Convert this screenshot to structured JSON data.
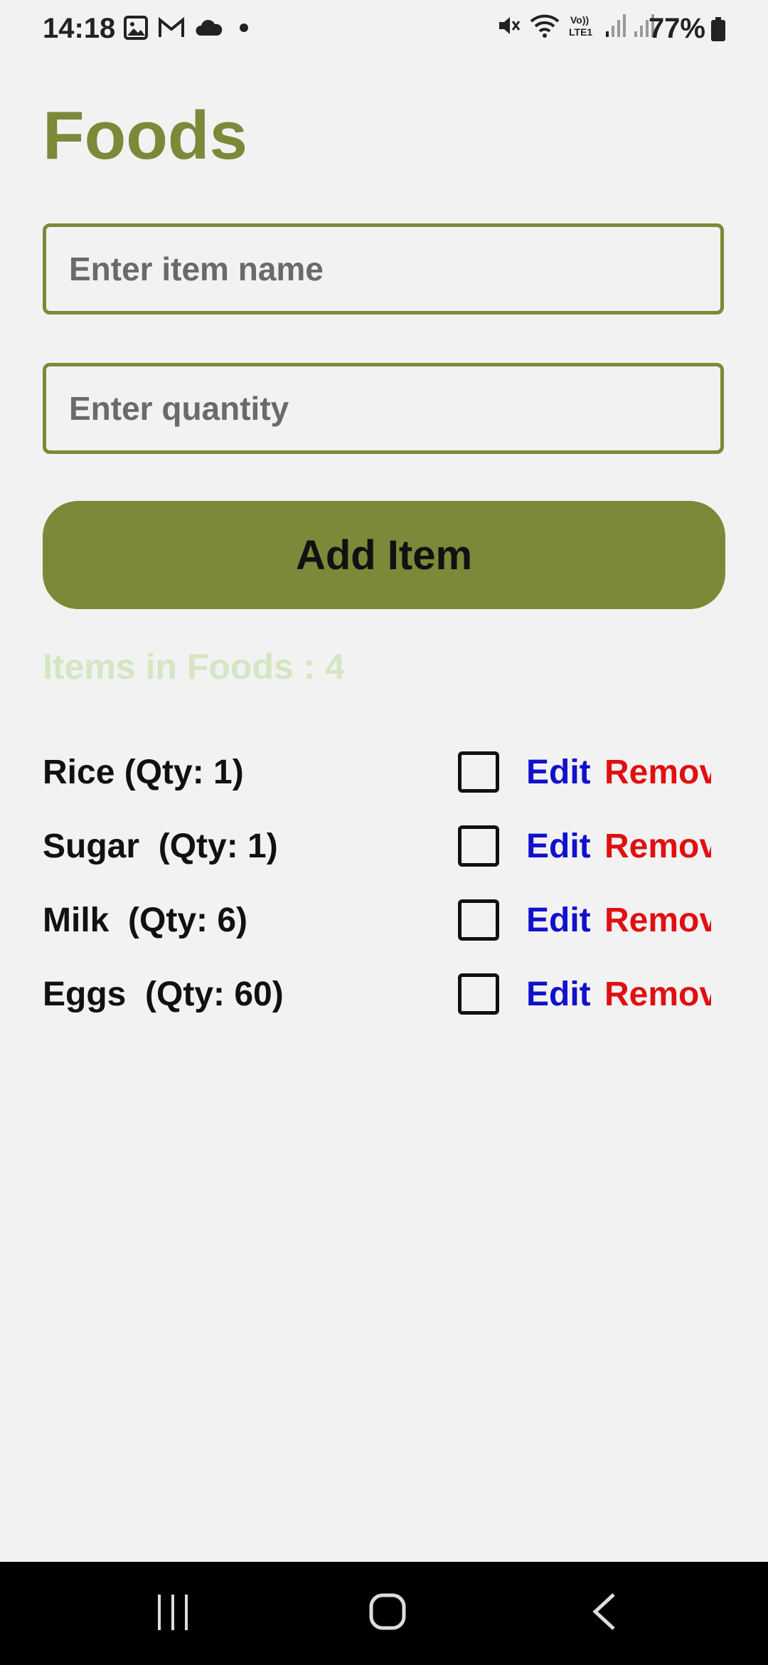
{
  "status_bar": {
    "time": "14:18",
    "battery": "77%",
    "left_icons": [
      "image-icon",
      "gmail-icon",
      "cloud-icon",
      "dot-icon"
    ],
    "right_icons": [
      "mute-icon",
      "wifi-icon",
      "volte-icon",
      "signal-icon",
      "signal-icon",
      "battery-icon"
    ]
  },
  "page": {
    "title": "Foods",
    "name_placeholder": "Enter item name",
    "qty_placeholder": "Enter quantity",
    "add_button": "Add Item",
    "count_text": "Items in Foods : 4",
    "count_color": "#d4e6c2",
    "accent_color": "#7a8a38"
  },
  "items": [
    {
      "label": "Rice (Qty: 1)",
      "edit": "Edit",
      "remove": "Remov",
      "checked": false
    },
    {
      "label": "Sugar  (Qty: 1)",
      "edit": "Edit",
      "remove": "Remov",
      "checked": false
    },
    {
      "label": "Milk  (Qty: 6)",
      "edit": "Edit",
      "remove": "Remov",
      "checked": false
    },
    {
      "label": "Eggs  (Qty: 60)",
      "edit": "Edit",
      "remove": "Remov",
      "checked": false
    }
  ],
  "nav_bar": {
    "buttons": [
      "recents-icon",
      "home-icon",
      "back-icon"
    ]
  }
}
